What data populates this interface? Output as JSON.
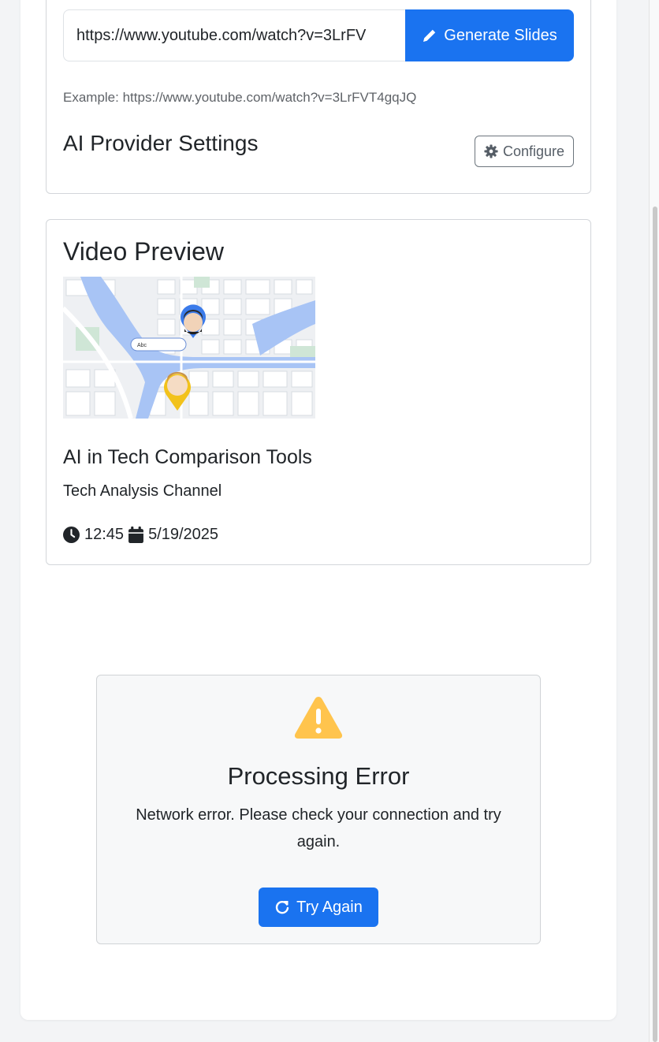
{
  "url_form": {
    "input_value": "https://www.youtube.com/watch?v=3LrFV",
    "generate_label": "Generate Slides",
    "example_text": "Example: https://www.youtube.com/watch?v=3LrFVT4gqJQ"
  },
  "ai_settings": {
    "title": "AI Provider Settings",
    "configure_label": "Configure"
  },
  "preview": {
    "title": "Video Preview",
    "map_label": "Abc",
    "video_title": "AI in Tech Comparison Tools",
    "channel": "Tech Analysis Channel",
    "duration": "12:45",
    "date": "5/19/2025"
  },
  "error": {
    "title": "Processing Error",
    "message": "Network error. Please check your connection and try again.",
    "retry_label": "Try Again"
  },
  "colors": {
    "primary": "#1a73f0",
    "warning": "#ffc107"
  }
}
